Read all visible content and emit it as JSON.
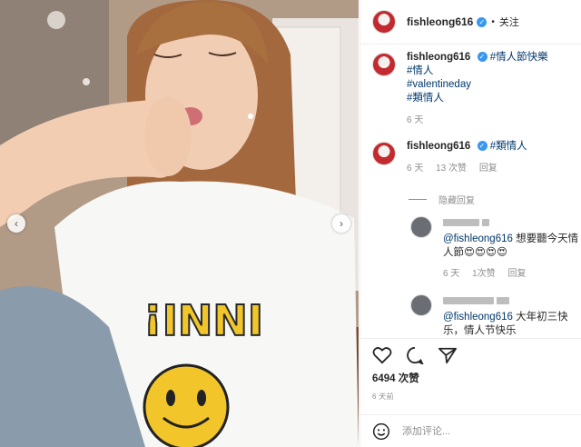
{
  "post": {
    "author": "fishleong616",
    "follow_label": "关注",
    "caption": {
      "author": "fishleong616",
      "lines": [
        "#情人節快樂",
        "#情人",
        "#valentineday",
        "#類情人"
      ],
      "time": "6 天"
    }
  },
  "comments": [
    {
      "author": "fishleong616",
      "text": "#類情人",
      "time": "6 天",
      "likes": "13 次赞",
      "reply_label": "回复"
    }
  ],
  "hide_replies_label": "隐藏回复",
  "replies": [
    {
      "mention": "@fishleong616",
      "text": " 想要聽今天情人節😍😍😍😍",
      "time": "6 天",
      "likes": "1次赞",
      "reply_label": "回复"
    },
    {
      "mention": "@fishleong616",
      "text": " 大年初三快乐，情人节快乐"
    }
  ],
  "actions": {
    "likes_count": "6494 次赞",
    "time_ago": "6 天前"
  },
  "composer": {
    "placeholder": "添加评论..."
  },
  "photo": {
    "shirt_text": "INNI!",
    "prev_icon": "chevron-left-icon",
    "next_icon": "chevron-right-icon"
  },
  "colors": {
    "link": "#00376b",
    "verified": "#3897f0",
    "muted": "#8e8e8e"
  }
}
